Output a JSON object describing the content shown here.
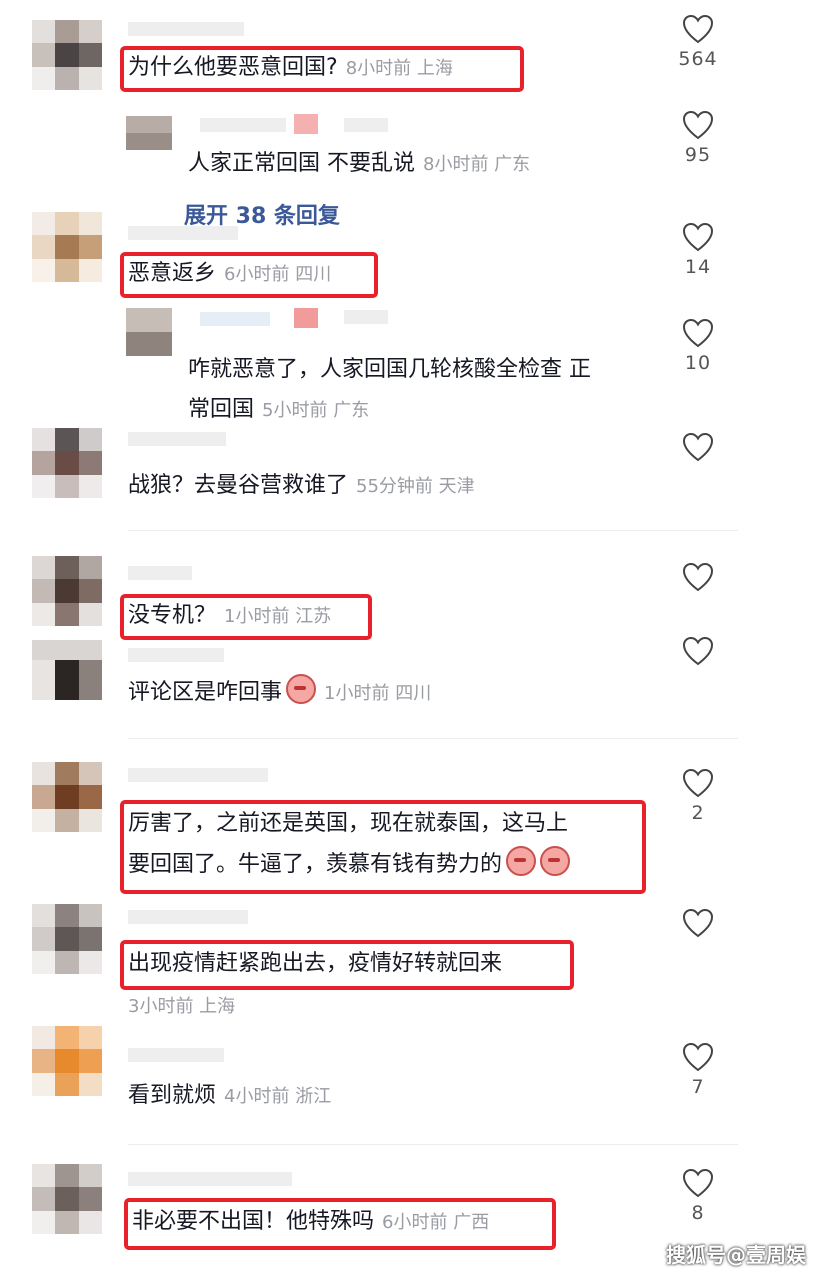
{
  "comments": [
    {
      "text": "为什么他要恶意回国?",
      "meta": "8小时前 上海",
      "likes": "564"
    },
    {
      "text": "人家正常回国 不要乱说",
      "meta": "8小时前 广东",
      "likes": "95"
    },
    {
      "expand": "展开 38 条回复"
    },
    {
      "text": "恶意返乡",
      "meta": "6小时前 四川",
      "likes": "14"
    },
    {
      "text_line1": "咋就恶意了，人家回国几轮核酸全检查 正",
      "text_line2": "常回国",
      "meta": "5小时前 广东",
      "likes": "10"
    },
    {
      "text": "战狼？去曼谷营救谁了",
      "meta": "55分钟前 天津",
      "likes": ""
    },
    {
      "text": "没专机？",
      "meta": "1小时前 江苏",
      "likes": ""
    },
    {
      "text": "评论区是咋回事",
      "meta": "1小时前 四川",
      "likes": ""
    },
    {
      "text_line1": "厉害了，之前还是英国，现在就泰国，这马上",
      "text_line2": "要回国了。牛逼了，羡慕有钱有势力的",
      "likes": "2"
    },
    {
      "text": "出现疫情赶紧跑出去，疫情好转就回来",
      "meta": "3小时前 上海",
      "likes": ""
    },
    {
      "text": "看到就烦",
      "meta": "4小时前 浙江",
      "likes": "7"
    },
    {
      "text": "非必要不出国！他特殊吗",
      "meta": "6小时前 广西",
      "likes": "8"
    }
  ],
  "watermark": "搜狐号@壹周娱",
  "colors": {
    "highlight_box": "#e8212b",
    "text": "#161823",
    "meta": "#9a9ca3",
    "expand": "#3b5998"
  },
  "icons": {
    "like": "heart-outline-icon",
    "emoji": "crying-face-emoji-icon"
  }
}
